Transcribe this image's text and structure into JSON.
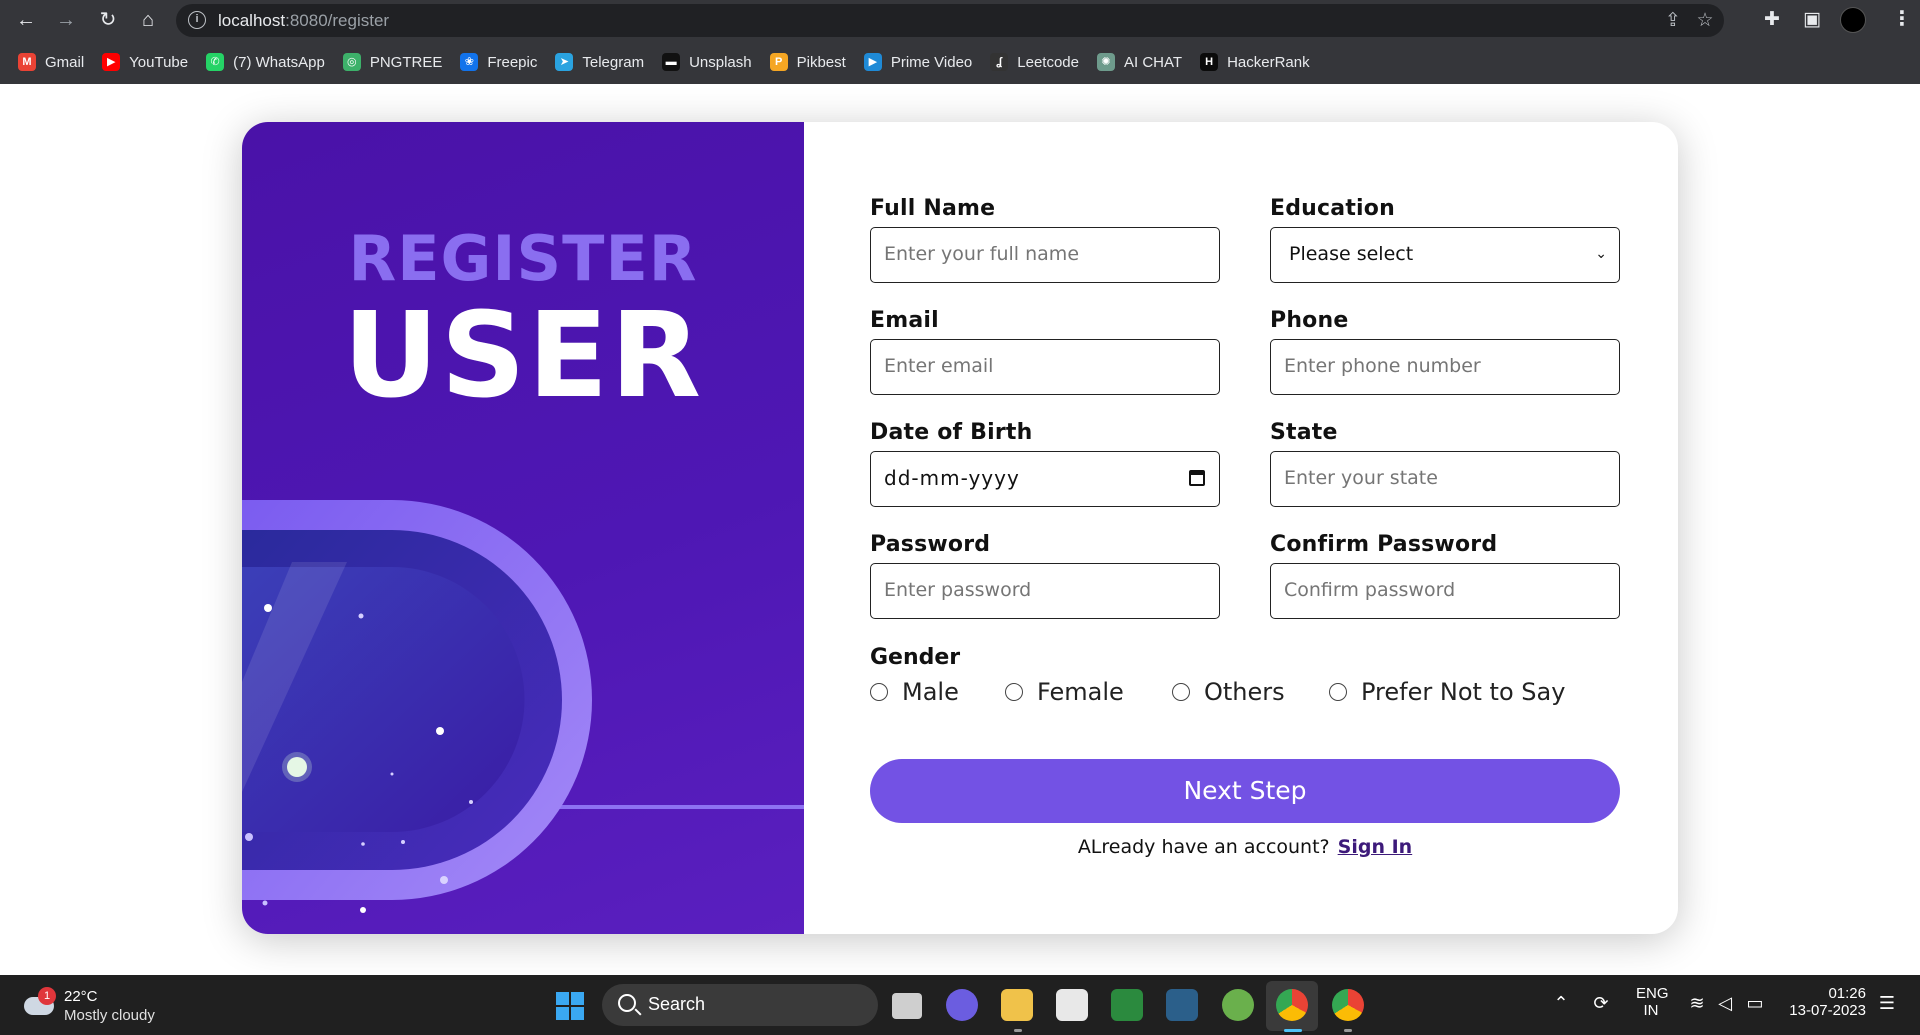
{
  "browser": {
    "url_host": "localhost",
    "url_path": ":8080/register",
    "bookmarks": [
      {
        "label": "Gmail",
        "color": "#ea4335",
        "glyph": "M"
      },
      {
        "label": "YouTube",
        "color": "#ff0000",
        "glyph": "▶"
      },
      {
        "label": "(7) WhatsApp",
        "color": "#25d366",
        "glyph": "✆"
      },
      {
        "label": "PNGTREE",
        "color": "#3db16a",
        "glyph": "◎"
      },
      {
        "label": "Freepic",
        "color": "#1273eb",
        "glyph": "❀"
      },
      {
        "label": "Telegram",
        "color": "#2aa3e0",
        "glyph": "➤"
      },
      {
        "label": "Unsplash",
        "color": "#111111",
        "glyph": "▬"
      },
      {
        "label": "Pikbest",
        "color": "#f5a623",
        "glyph": "P"
      },
      {
        "label": "Prime Video",
        "color": "#1f8ad6",
        "glyph": "▶"
      },
      {
        "label": "Leetcode",
        "color": "#333333",
        "glyph": "ʆ"
      },
      {
        "label": "AI CHAT",
        "color": "#6e9b8c",
        "glyph": "✺"
      },
      {
        "label": "HackerRank",
        "color": "#0b0b0b",
        "glyph": "H"
      }
    ]
  },
  "hero": {
    "line1": "REGISTER",
    "line2": "USER"
  },
  "form": {
    "full_name": {
      "label": "Full Name",
      "placeholder": "Enter your full name"
    },
    "education": {
      "label": "Education",
      "value": "Please select"
    },
    "email": {
      "label": "Email",
      "placeholder": "Enter email"
    },
    "phone": {
      "label": "Phone",
      "placeholder": "Enter phone number"
    },
    "dob": {
      "label": "Date of Birth",
      "placeholder": "dd-mm-yyyy"
    },
    "state": {
      "label": "State",
      "placeholder": "Enter your state"
    },
    "password": {
      "label": "Password",
      "placeholder": "Enter password"
    },
    "confirm_password": {
      "label": "Confirm Password",
      "placeholder": "Confirm password"
    },
    "gender": {
      "label": "Gender",
      "options": [
        "Male",
        "Female",
        "Others",
        "Prefer Not to Say"
      ]
    },
    "next_button": "Next Step",
    "signin_prompt": "ALready have an account?",
    "signin_link": "Sign In"
  },
  "colors": {
    "panel": "#4e17b4",
    "button": "#7352e4",
    "title_accent": "#8a6ef0"
  },
  "taskbar": {
    "weather_temp": "22°C",
    "weather_desc": "Mostly cloudy",
    "weather_badge": "1",
    "search_label": "Search",
    "lang_top": "ENG",
    "lang_bottom": "IN",
    "time": "01:26",
    "date": "13-07-2023"
  }
}
